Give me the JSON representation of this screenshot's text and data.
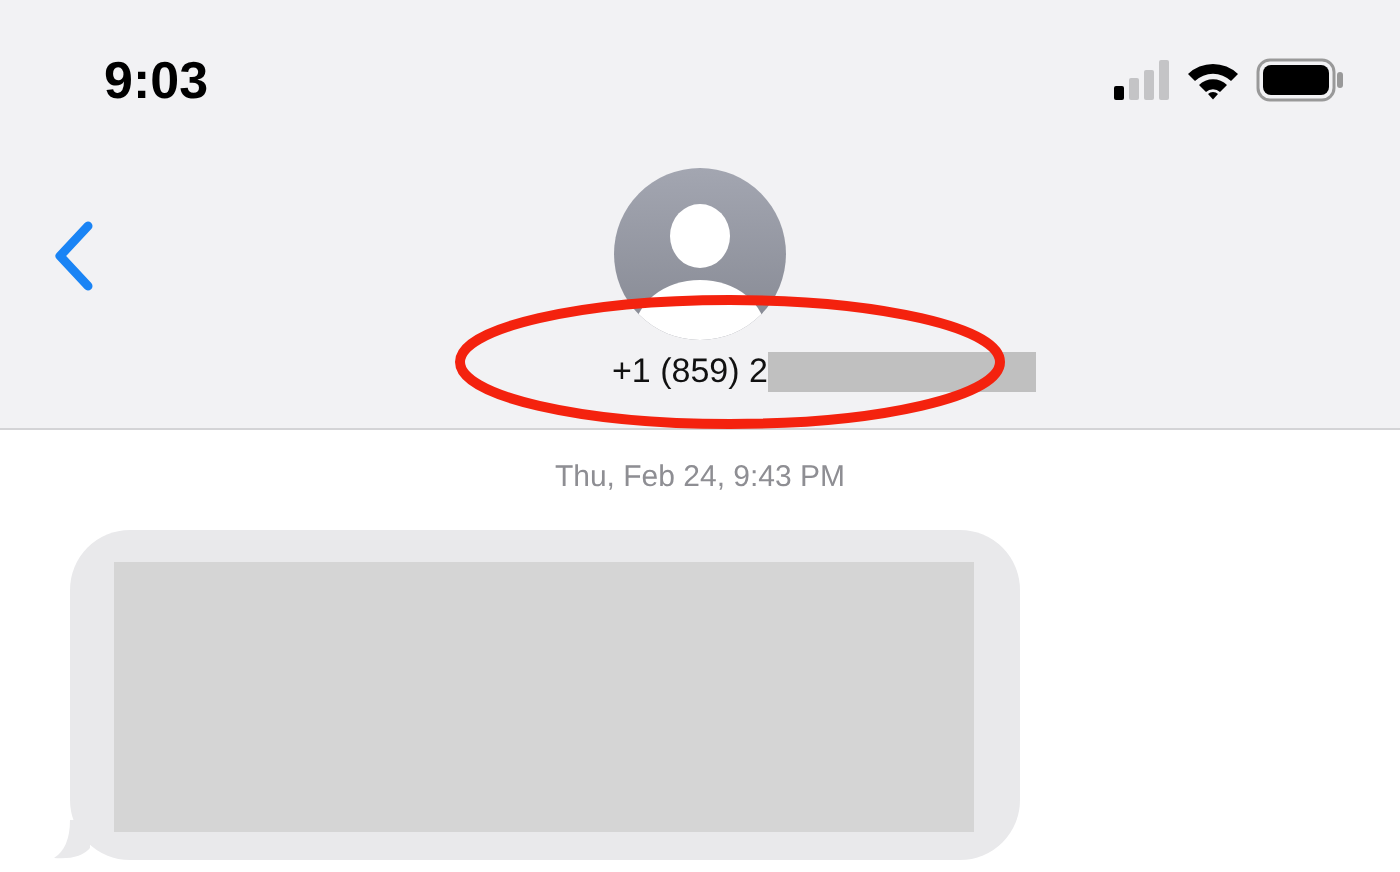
{
  "status_bar": {
    "time": "9:03"
  },
  "header": {
    "contact": "+1 (859) 2",
    "contact_redacted": true
  },
  "timestamp": "Thu, Feb 24, 9:43 PM",
  "messages": [
    {
      "kind": "received",
      "redacted": true
    }
  ]
}
